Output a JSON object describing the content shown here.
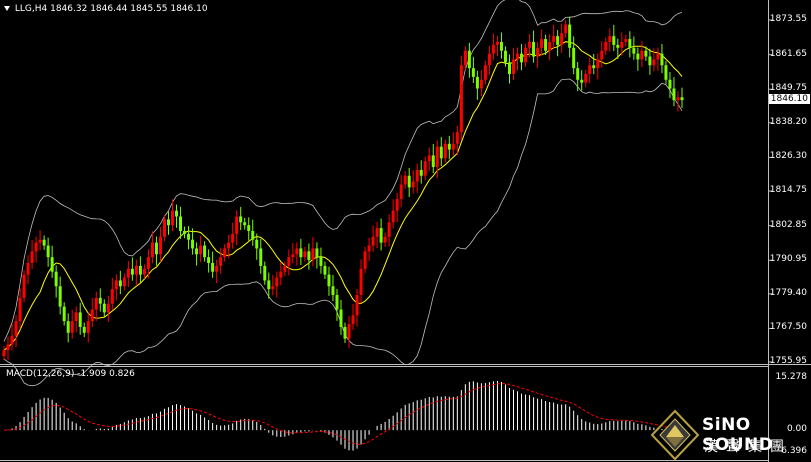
{
  "header": {
    "symbol": "LLG,H4",
    "ohlc": "1846.32 1846.44 1845.55 1846.10"
  },
  "price_axis": {
    "ticks": [
      "1873.55",
      "1861.65",
      "1849.75",
      "1838.20",
      "1826.30",
      "1814.75",
      "1802.85",
      "1790.95",
      "1779.40",
      "1767.50",
      "1755.95"
    ],
    "current_price": "1846.10"
  },
  "macd": {
    "title": "MACD(12,26,9) -1.909 0.826",
    "ticks": [
      "15.278",
      "0.00",
      "-6.396"
    ]
  },
  "logo": {
    "brand": "SiNO SOUND",
    "brand_cn": "漢聲集團"
  },
  "colors": {
    "bull": "#ff0000",
    "bear": "#7CFC00",
    "ma": "#ffff00",
    "bands": "#c0c0c0",
    "signal": "#ff0000",
    "histogram": "#ffffff",
    "background": "#000000"
  },
  "chart_data": [
    {
      "type": "candlestick",
      "title": "LLG,H4",
      "ylim": [
        1755.95,
        1877
      ],
      "x": [
        1,
        2,
        3,
        4,
        5,
        6,
        7,
        8,
        9,
        10,
        11,
        12,
        13,
        14,
        15,
        16,
        17,
        18,
        19,
        20,
        21,
        22,
        23,
        24,
        25,
        26,
        27,
        28,
        29,
        30,
        31,
        32,
        33,
        34,
        35,
        36,
        37,
        38,
        39,
        40,
        41,
        42,
        43,
        44,
        45,
        46,
        47,
        48,
        49,
        50,
        51,
        52,
        53,
        54,
        55,
        56,
        57,
        58,
        59,
        60,
        61,
        62,
        63,
        64,
        65,
        66,
        67,
        68,
        69,
        70,
        71,
        72,
        73,
        74,
        75,
        76,
        77,
        78,
        79,
        80,
        81,
        82,
        83,
        84,
        85,
        86,
        87,
        88,
        89,
        90,
        91,
        92,
        93,
        94,
        95,
        96,
        97,
        98,
        99,
        100,
        101,
        102,
        103,
        104,
        105,
        106,
        107,
        108,
        109,
        110,
        111,
        112,
        113,
        114,
        115,
        116,
        117,
        118,
        119,
        120,
        121,
        122,
        123,
        124,
        125,
        126,
        127,
        128,
        129,
        130,
        131,
        132,
        133,
        134,
        135,
        136,
        137,
        138,
        139,
        140,
        141,
        142,
        143,
        144,
        145,
        146,
        147,
        148,
        149,
        150,
        151,
        152,
        153,
        154,
        155,
        156,
        157,
        158,
        159,
        160,
        161,
        162,
        163,
        164,
        165,
        166,
        167,
        168,
        169,
        170
      ],
      "close": [
        1760,
        1762,
        1765,
        1770,
        1778,
        1786,
        1790,
        1794,
        1797,
        1798,
        1796,
        1792,
        1787,
        1782,
        1775,
        1770,
        1766,
        1770,
        1773,
        1768,
        1766,
        1770,
        1774,
        1778,
        1776,
        1773,
        1776,
        1781,
        1784,
        1782,
        1785,
        1788,
        1786,
        1789,
        1786,
        1788,
        1792,
        1797,
        1793,
        1799,
        1805,
        1803,
        1808,
        1806,
        1801,
        1800,
        1798,
        1795,
        1793,
        1796,
        1792,
        1790,
        1787,
        1789,
        1792,
        1795,
        1797,
        1800,
        1806,
        1804,
        1803,
        1801,
        1798,
        1795,
        1789,
        1784,
        1781,
        1782,
        1785,
        1787,
        1789,
        1792,
        1793,
        1795,
        1792,
        1794,
        1791,
        1795,
        1792,
        1789,
        1786,
        1782,
        1779,
        1774,
        1768,
        1764,
        1769,
        1772,
        1779,
        1788,
        1794,
        1796,
        1799,
        1802,
        1797,
        1799,
        1804,
        1808,
        1812,
        1817,
        1820,
        1816,
        1818,
        1822,
        1820,
        1825,
        1827,
        1823,
        1830,
        1826,
        1831,
        1829,
        1831,
        1835,
        1858,
        1863,
        1857,
        1854,
        1850,
        1853,
        1858,
        1862,
        1865,
        1866,
        1863,
        1859,
        1855,
        1860,
        1862,
        1859,
        1864,
        1866,
        1861,
        1864,
        1867,
        1863,
        1866,
        1868,
        1865,
        1869,
        1872,
        1864,
        1857,
        1853,
        1852,
        1855,
        1858,
        1857,
        1860,
        1863,
        1866,
        1868,
        1865,
        1864,
        1866,
        1867,
        1864,
        1862,
        1860,
        1863,
        1861,
        1858,
        1860,
        1862,
        1858,
        1853,
        1850,
        1846,
        1847,
        1846
      ]
    },
    {
      "type": "line",
      "title": "MACD(12,26,9)",
      "series": [
        {
          "name": "MACD",
          "values": [
            -1.909
          ]
        },
        {
          "name": "Signal",
          "values": [
            0.826
          ]
        }
      ],
      "ylim": [
        -6.396,
        15.278
      ]
    }
  ]
}
